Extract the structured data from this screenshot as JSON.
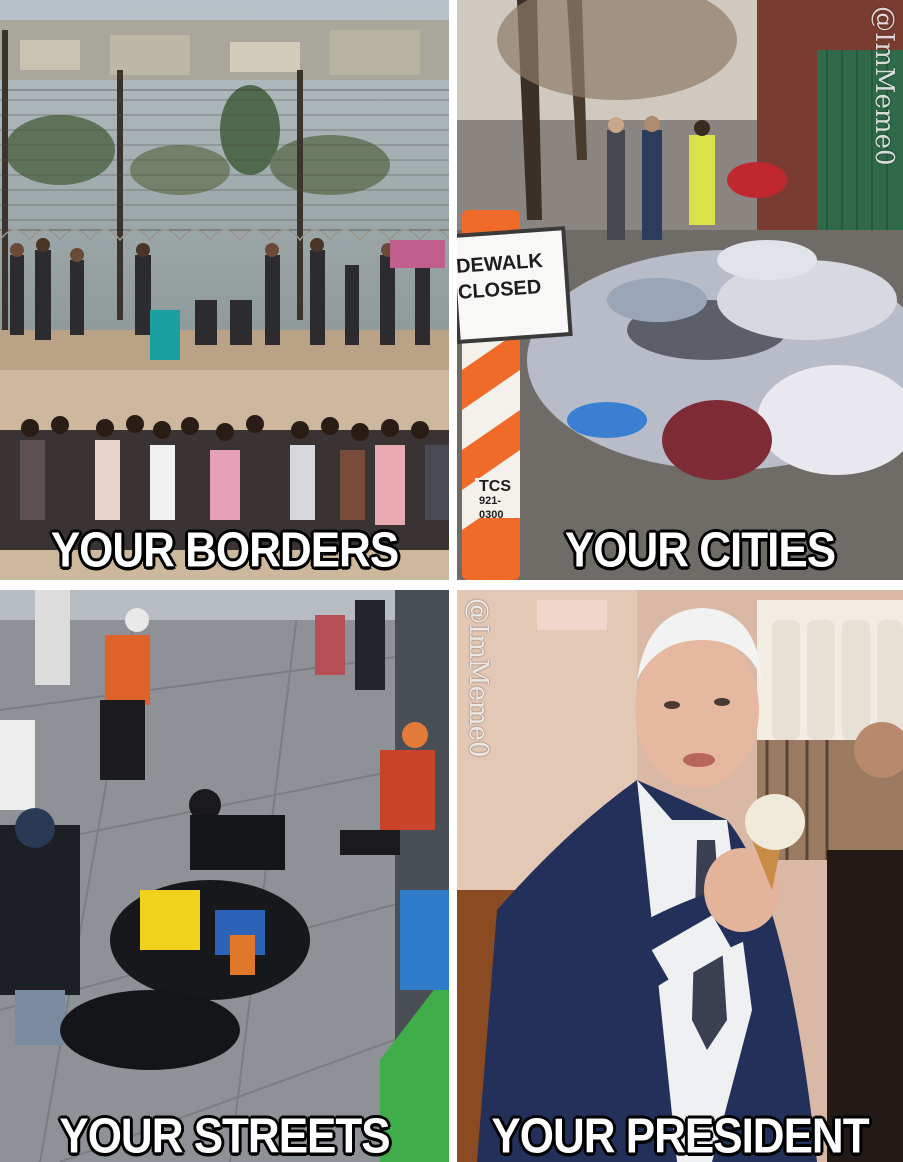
{
  "panels": [
    {
      "caption": "YOUR BORDERS"
    },
    {
      "caption": "YOUR CITIES",
      "watermark": "@ImMeme0",
      "sign_line1": "DEWALK",
      "sign_line2": "CLOSED",
      "barrel_text": "TCS",
      "barrel_phone": "921-0300"
    },
    {
      "caption": "YOUR STREETS"
    },
    {
      "caption": "YOUR PRESIDENT",
      "watermark": "@ImMeme0"
    }
  ],
  "colors": {
    "caption_fill": "#ffffff",
    "caption_stroke": "#000000",
    "barrel_orange": "#f06a2a",
    "fence_green": "#2f6b4a",
    "suit_navy": "#22305a"
  }
}
